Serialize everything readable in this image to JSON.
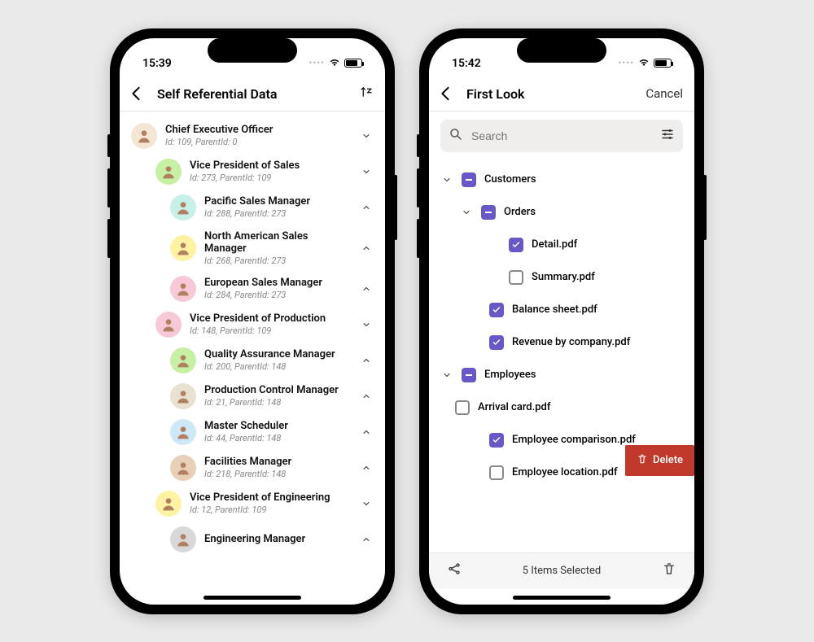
{
  "left_phone": {
    "time": "15:39",
    "title": "Self Referential Data",
    "rows": [
      {
        "title": "Chief Executive Officer",
        "sub": "Id: 109, ParentId: 0",
        "indent": 0,
        "expanded": true,
        "color": "#f5e5d5"
      },
      {
        "title": "Vice President of Sales",
        "sub": "Id: 273, ParentId: 109",
        "indent": 1,
        "expanded": true,
        "color": "#c6f0a3"
      },
      {
        "title": "Pacific Sales Manager",
        "sub": "Id: 288, ParentId: 273",
        "indent": 2,
        "expanded": false,
        "color": "#c6f0e8"
      },
      {
        "title": "North American Sales Manager",
        "sub": "Id: 268, ParentId: 273",
        "indent": 2,
        "expanded": false,
        "color": "#fff3a3"
      },
      {
        "title": "European Sales Manager",
        "sub": "Id: 284, ParentId: 273",
        "indent": 2,
        "expanded": false,
        "color": "#f7c8d6"
      },
      {
        "title": "Vice President of Production",
        "sub": "Id: 148, ParentId: 109",
        "indent": 1,
        "expanded": true,
        "color": "#f7c8d6"
      },
      {
        "title": "Quality Assurance Manager",
        "sub": "Id: 200, ParentId: 148",
        "indent": 2,
        "expanded": false,
        "color": "#c6f0a3"
      },
      {
        "title": "Production Control Manager",
        "sub": "Id: 21, ParentId: 148",
        "indent": 2,
        "expanded": false,
        "color": "#e8e0d0"
      },
      {
        "title": "Master Scheduler",
        "sub": "Id: 44, ParentId: 148",
        "indent": 2,
        "expanded": false,
        "color": "#cfe8f7"
      },
      {
        "title": "Facilities Manager",
        "sub": "Id: 218, ParentId: 148",
        "indent": 2,
        "expanded": false,
        "color": "#e8d0b8"
      },
      {
        "title": "Vice President of Engineering",
        "sub": "Id: 12, ParentId: 109",
        "indent": 1,
        "expanded": true,
        "color": "#fff3a3"
      },
      {
        "title": "Engineering Manager",
        "sub": "",
        "indent": 2,
        "expanded": false,
        "color": "#d8d8d8"
      }
    ]
  },
  "right_phone": {
    "time": "15:42",
    "title": "First Look",
    "cancel_label": "Cancel",
    "search_placeholder": "Search",
    "delete_label": "Delete",
    "selected_text": "5 Items Selected",
    "tree": [
      {
        "label": "Customers",
        "indent": 0,
        "expand": "down",
        "state": "indeterminate"
      },
      {
        "label": "Orders",
        "indent": 1,
        "expand": "down",
        "state": "indeterminate"
      },
      {
        "label": "Detail.pdf",
        "indent": 2,
        "expand": "none",
        "state": "checked"
      },
      {
        "label": "Summary.pdf",
        "indent": 2,
        "expand": "none",
        "state": "unchecked"
      },
      {
        "label": "Balance sheet.pdf",
        "indent": 2,
        "expand": "none",
        "state": "checked",
        "back": 1
      },
      {
        "label": "Revenue by company.pdf",
        "indent": 2,
        "expand": "none",
        "state": "checked",
        "back": 1
      },
      {
        "label": "Employees",
        "indent": 0,
        "expand": "down",
        "state": "indeterminate"
      },
      {
        "label": "Arrival card.pdf",
        "indent": 0,
        "expand": "none",
        "state": "unchecked",
        "flush": true
      },
      {
        "label": "Employee comparison.pdf",
        "indent": 2,
        "expand": "none",
        "state": "checked",
        "back": 1
      },
      {
        "label": "Employee location.pdf",
        "indent": 2,
        "expand": "none",
        "state": "unchecked",
        "back": 1
      }
    ]
  }
}
